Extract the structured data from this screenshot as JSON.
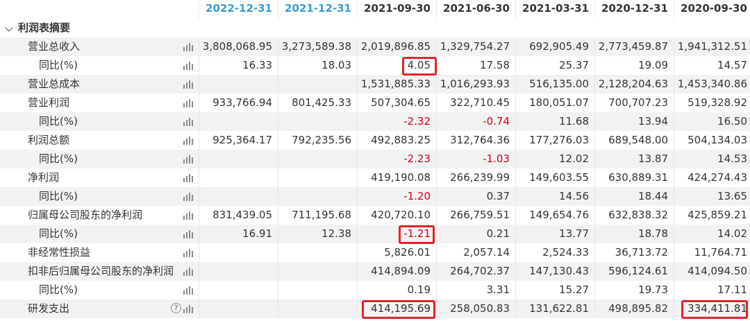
{
  "columns": [
    "2022-12-31",
    "2021-12-31",
    "2021-09-30",
    "2021-06-30",
    "2021-03-31",
    "2020-12-31",
    "2020-09-30"
  ],
  "section_title": "利润表摘要",
  "rows": [
    {
      "label": "营业总收入",
      "indent": 1,
      "values": [
        "3,808,068.95",
        "3,273,589.38",
        "2,019,896.85",
        "1,329,754.27",
        "692,905.49",
        "2,773,459.87",
        "1,941,312.51"
      ]
    },
    {
      "label": "同比(%)",
      "indent": 2,
      "values": [
        "16.33",
        "18.03",
        "4.05",
        "17.58",
        "25.37",
        "19.09",
        "14.57"
      ]
    },
    {
      "label": "营业总成本",
      "indent": 1,
      "values": [
        "",
        "",
        "1,531,885.33",
        "1,016,293.93",
        "516,135.00",
        "2,128,204.63",
        "1,453,340.86"
      ]
    },
    {
      "label": "营业利润",
      "indent": 1,
      "values": [
        "933,766.94",
        "801,425.33",
        "507,304.65",
        "322,710.45",
        "180,051.07",
        "700,707.23",
        "519,328.92"
      ]
    },
    {
      "label": "同比(%)",
      "indent": 2,
      "values": [
        "",
        "",
        "-2.32",
        "-0.74",
        "11.68",
        "13.94",
        "16.50"
      ]
    },
    {
      "label": "利润总额",
      "indent": 1,
      "values": [
        "925,364.17",
        "792,235.56",
        "492,883.25",
        "312,764.36",
        "177,276.03",
        "689,548.00",
        "504,134.03"
      ]
    },
    {
      "label": "同比(%)",
      "indent": 2,
      "values": [
        "",
        "",
        "-2.23",
        "-1.03",
        "12.02",
        "13.87",
        "14.53"
      ]
    },
    {
      "label": "净利润",
      "indent": 1,
      "values": [
        "",
        "",
        "419,190.08",
        "266,239.99",
        "149,603.55",
        "630,889.31",
        "424,274.43"
      ]
    },
    {
      "label": "同比(%)",
      "indent": 2,
      "values": [
        "",
        "",
        "-1.20",
        "0.37",
        "14.56",
        "18.44",
        "13.65"
      ]
    },
    {
      "label": "归属母公司股东的净利润",
      "indent": 1,
      "values": [
        "831,439.05",
        "711,195.68",
        "420,720.10",
        "266,759.51",
        "149,654.76",
        "632,838.32",
        "425,859.21"
      ]
    },
    {
      "label": "同比(%)",
      "indent": 2,
      "values": [
        "16.91",
        "12.38",
        "-1.21",
        "0.21",
        "13.77",
        "18.78",
        "14.02"
      ]
    },
    {
      "label": "非经常性损益",
      "indent": 1,
      "values": [
        "",
        "",
        "5,826.01",
        "2,057.14",
        "2,524.33",
        "36,713.72",
        "11,764.71"
      ]
    },
    {
      "label": "扣非后归属母公司股东的净利润",
      "indent": 1,
      "values": [
        "",
        "",
        "414,894.09",
        "264,702.37",
        "147,130.43",
        "596,124.61",
        "414,094.50"
      ]
    },
    {
      "label": "同比(%)",
      "indent": 2,
      "values": [
        "",
        "",
        "0.19",
        "3.31",
        "15.27",
        "19.73",
        "17.11"
      ]
    },
    {
      "label": "研发支出",
      "indent": 1,
      "values": [
        "",
        "",
        "414,195.69",
        "258,050.83",
        "131,622.81",
        "498,895.82",
        "334,411.81"
      ],
      "help": "?"
    }
  ],
  "colors": {
    "header_blue": "#3a9ad9",
    "negative": "#d0021b",
    "highlight": "#e0242b",
    "stripe": "#f2f2f2"
  },
  "icons": {
    "expand": "chevron-down-icon",
    "chart": "bar-chart-icon",
    "help": "question-circle-icon"
  }
}
